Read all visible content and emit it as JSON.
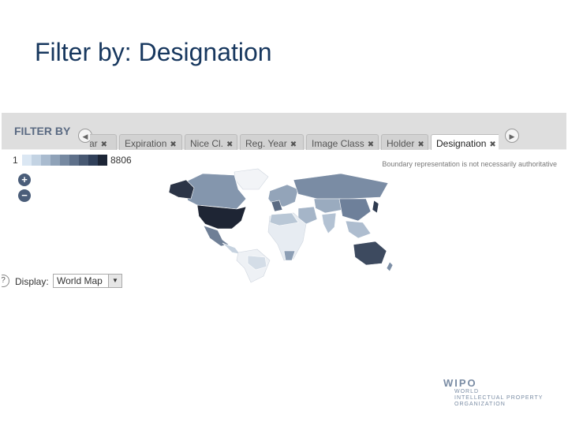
{
  "slide": {
    "title": "Filter by: Designation"
  },
  "filter_panel": {
    "label": "FILTER BY",
    "tabs": [
      {
        "label": "ar",
        "close": "✖",
        "active": false
      },
      {
        "label": "Expiration",
        "close": "✖",
        "active": false
      },
      {
        "label": "Nice Cl.",
        "close": "✖",
        "active": false
      },
      {
        "label": "Reg. Year",
        "close": "✖",
        "active": false
      },
      {
        "label": "Image Class",
        "close": "✖",
        "active": false
      },
      {
        "label": "Holder",
        "close": "✖",
        "active": false
      },
      {
        "label": "Designation",
        "close": "✖",
        "active": true
      }
    ],
    "prev_icon": "chevron-left-icon",
    "next_icon": "chevron-right-icon"
  },
  "map": {
    "legend_min": "1",
    "legend_max": "8806",
    "legend_colors": [
      "#dbe7f3",
      "#c3d3e3",
      "#a9bbcf",
      "#8fa2b8",
      "#7689a1",
      "#5e708a",
      "#475872",
      "#30405a",
      "#1c2536"
    ],
    "disclaimer": "Boundary representation is not necessarily authoritative",
    "zoom_in": "+",
    "zoom_out": "−",
    "help": "?",
    "display_label": "Display:",
    "display_value": "World Map",
    "display_drop": "▼"
  },
  "footer": {
    "logo_name": "WIPO",
    "logo_line1": "WORLD",
    "logo_line2": "INTELLECTUAL PROPERTY",
    "logo_line3": "ORGANIZATION"
  }
}
